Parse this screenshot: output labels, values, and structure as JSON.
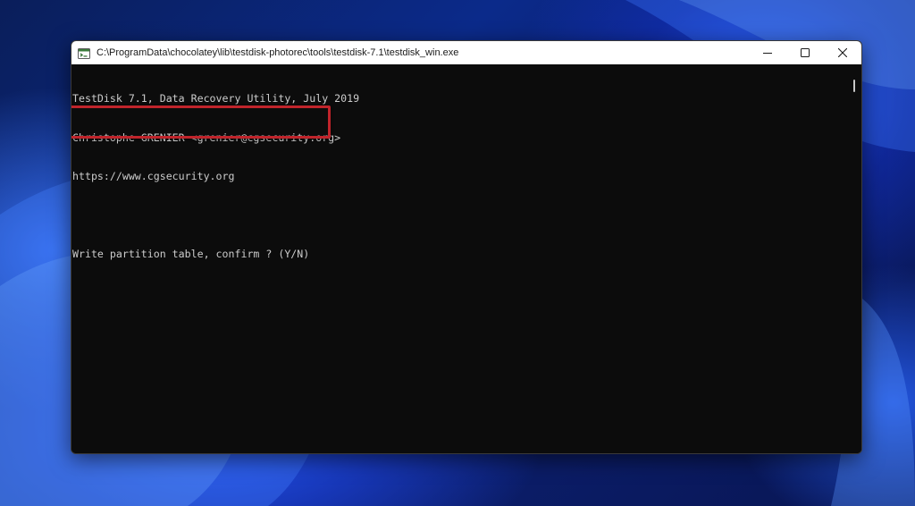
{
  "window": {
    "title": "C:\\ProgramData\\chocolatey\\lib\\testdisk-photorec\\tools\\testdisk-7.1\\testdisk_win.exe",
    "icon": "console-app-icon",
    "controls": {
      "minimize_icon": "minimize-icon",
      "maximize_icon": "maximize-icon",
      "close_icon": "close-icon"
    }
  },
  "terminal": {
    "lines": [
      "TestDisk 7.1, Data Recovery Utility, July 2019",
      "Christophe GRENIER <grenier@cgsecurity.org>",
      "https://www.cgsecurity.org",
      "",
      "Write partition table, confirm ? (Y/N)"
    ],
    "text_color": "#cccccc",
    "background_color": "#0c0c0c"
  },
  "annotation": {
    "highlight_color": "#c0242b",
    "highlighted_line_index": 4
  }
}
